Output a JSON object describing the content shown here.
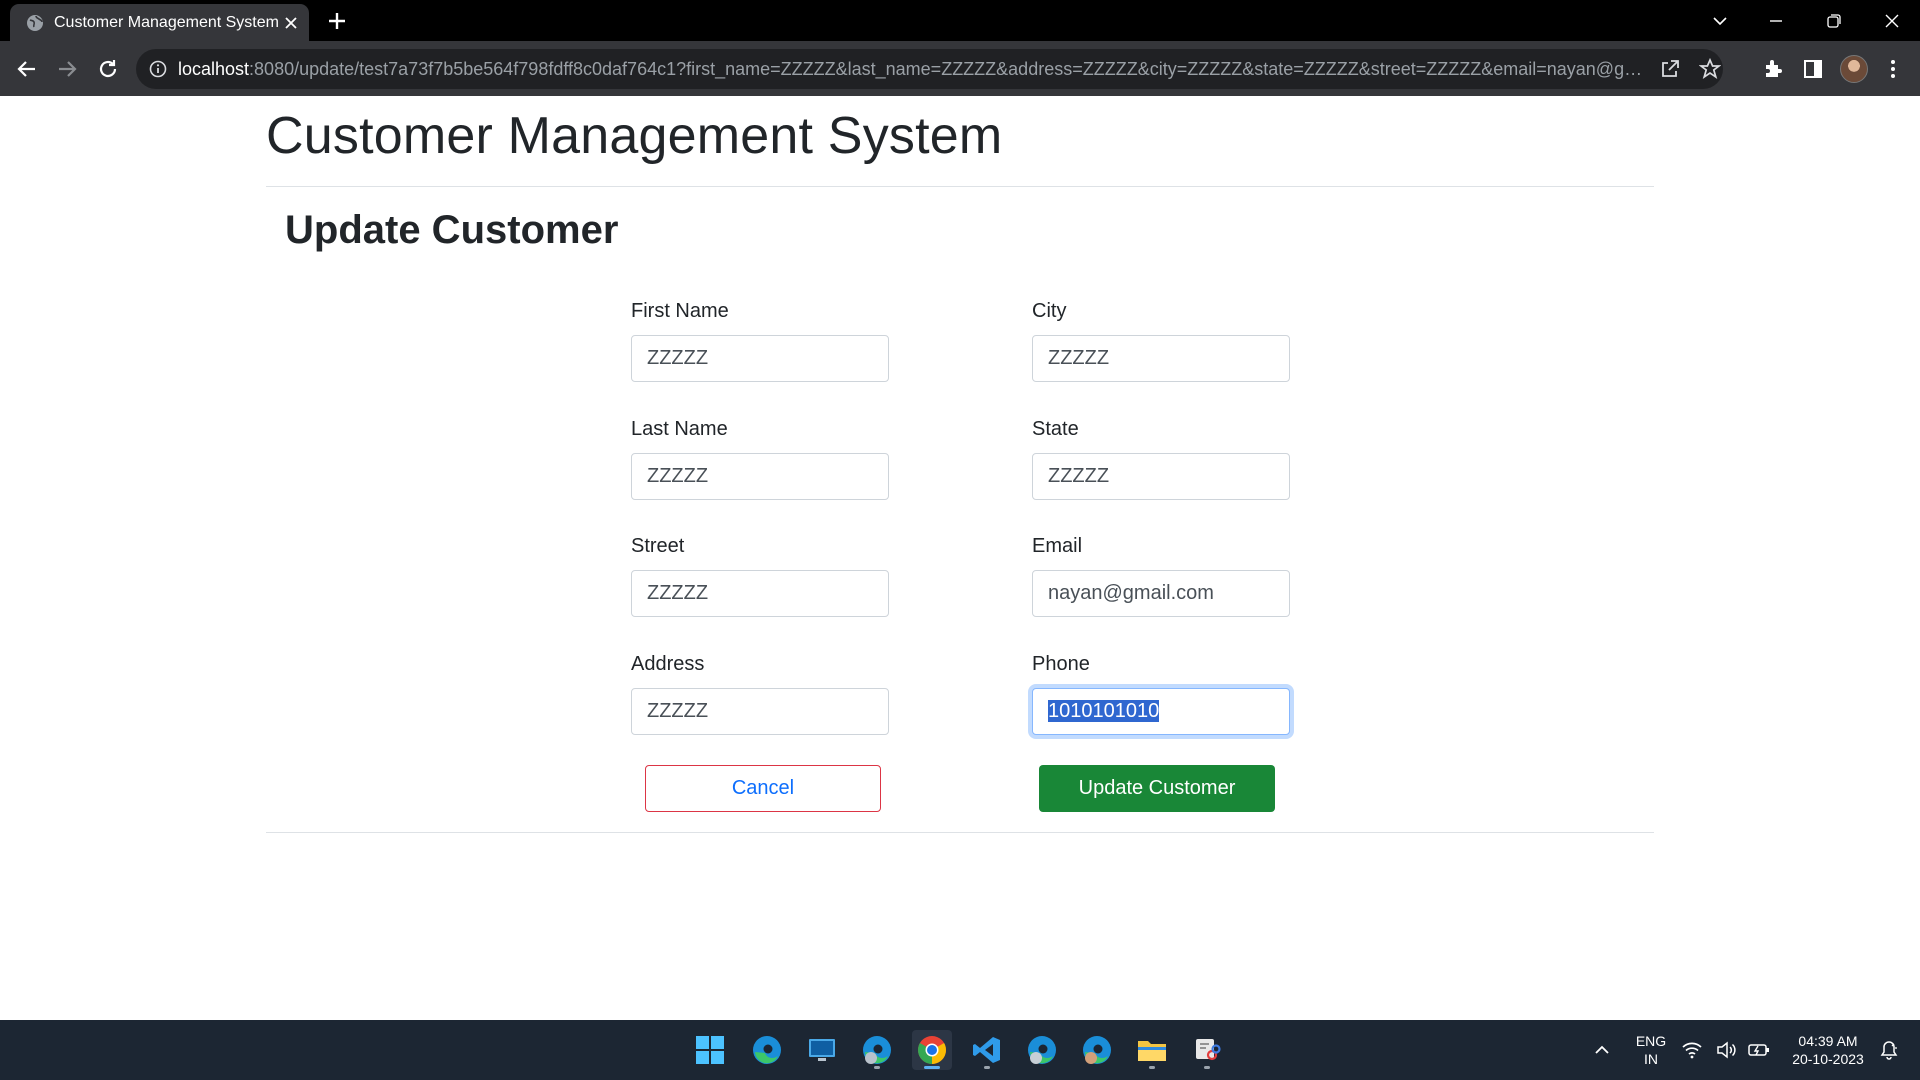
{
  "browser": {
    "tab_title": "Customer Management System",
    "url_host": "localhost",
    "url_rest": ":8080/update/test7a73f7b5be564f798fdff8c0daf764c1?first_name=ZZZZZ&last_name=ZZZZZ&address=ZZZZZ&city=ZZZZZ&state=ZZZZZ&street=ZZZZZ&email=nayan@gmail.com..."
  },
  "page": {
    "app_title": "Customer Management System",
    "section_title": "Update Customer",
    "fields": {
      "first_name": {
        "label": "First Name",
        "value": "ZZZZZ"
      },
      "last_name": {
        "label": "Last Name",
        "value": "ZZZZZ"
      },
      "street": {
        "label": "Street",
        "value": "ZZZZZ"
      },
      "address": {
        "label": "Address",
        "value": "ZZZZZ"
      },
      "city": {
        "label": "City",
        "value": "ZZZZZ"
      },
      "state": {
        "label": "State",
        "value": "ZZZZZ"
      },
      "email": {
        "label": "Email",
        "value": "nayan@gmail.com"
      },
      "phone": {
        "label": "Phone",
        "value": "1010101010"
      }
    },
    "buttons": {
      "cancel": "Cancel",
      "update": "Update Customer"
    }
  },
  "taskbar": {
    "apps": [
      "start-icon",
      "edge-icon",
      "desktop-icon",
      "edge-profile-icon",
      "chrome-icon",
      "vscode-icon",
      "edge-profile-2-icon",
      "edge-profile-3-icon",
      "file-explorer-icon",
      "snipping-tool-icon"
    ],
    "language": "ENG",
    "region": "IN",
    "time": "04:39 AM",
    "date": "20-10-2023"
  },
  "colors": {
    "primary_green": "#198737",
    "cancel_border": "#dc3545",
    "link_blue": "#0d6efd",
    "taskbar_bg": "#1c2633"
  }
}
